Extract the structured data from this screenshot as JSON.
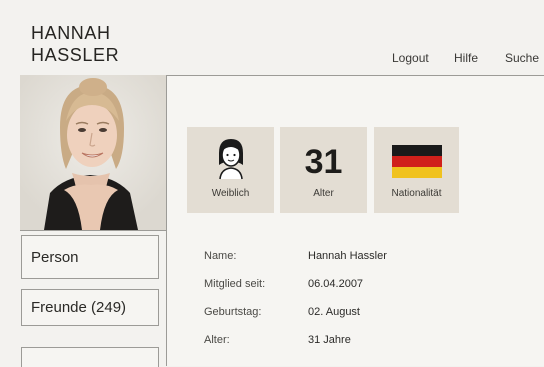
{
  "profile": {
    "first_name": "HANNAH",
    "last_name": "HASSLER"
  },
  "topnav": [
    {
      "label": "Logout"
    },
    {
      "label": "Hilfe"
    },
    {
      "label": "Suche"
    }
  ],
  "sidebar": {
    "items": [
      {
        "label": "Person"
      },
      {
        "label": "Freunde (249)"
      }
    ]
  },
  "stats": {
    "gender": {
      "label": "Weiblich",
      "icon": "female-avatar-icon"
    },
    "age": {
      "value": "31",
      "label": "Alter"
    },
    "nationality": {
      "label": "Nationalität",
      "icon": "german-flag-icon",
      "colors": [
        "#1a1a1a",
        "#d0201b",
        "#f0c21e"
      ]
    }
  },
  "details": [
    {
      "key": "Name:",
      "value": "Hannah Hassler"
    },
    {
      "key": "Mitglied seit:",
      "value": "06.04.2007"
    },
    {
      "key": "Geburtstag:",
      "value": "02. August"
    },
    {
      "key": "Alter:",
      "value": "31 Jahre"
    }
  ]
}
